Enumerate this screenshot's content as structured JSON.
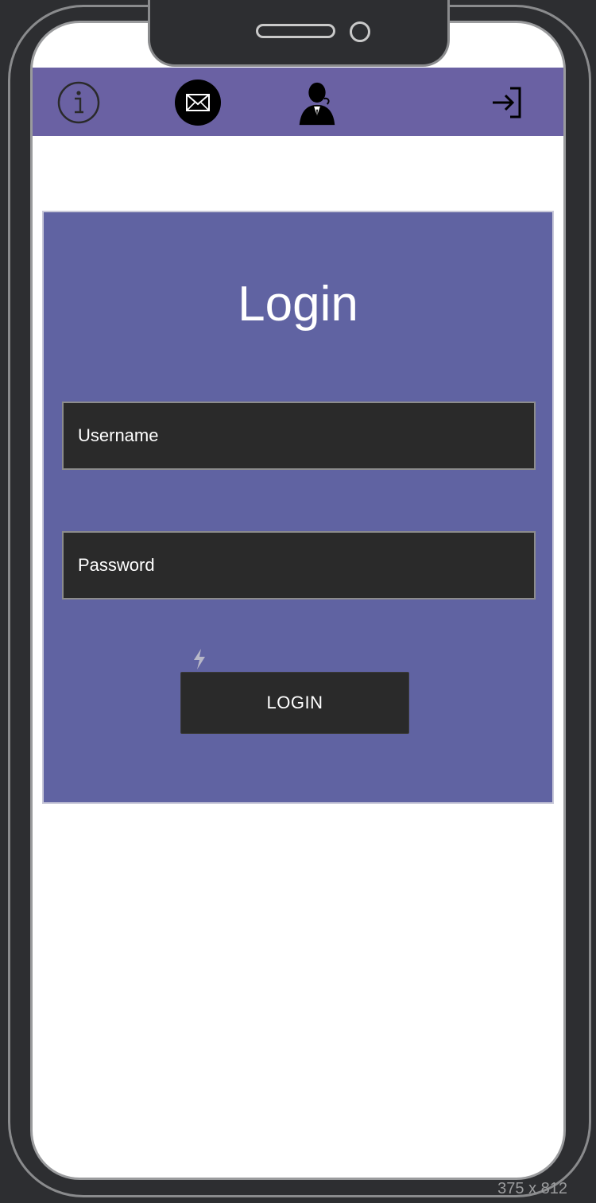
{
  "nav": {
    "icons": [
      "info-icon",
      "mail-icon",
      "user-profile-icon",
      "sign-in-icon"
    ],
    "bar_color": "#6a61a3"
  },
  "login_card": {
    "title": "Login",
    "username_placeholder": "Username",
    "password_placeholder": "Password",
    "button_label": "LOGIN",
    "card_color": "#6063a2"
  },
  "viewport_label": "375 x 812"
}
